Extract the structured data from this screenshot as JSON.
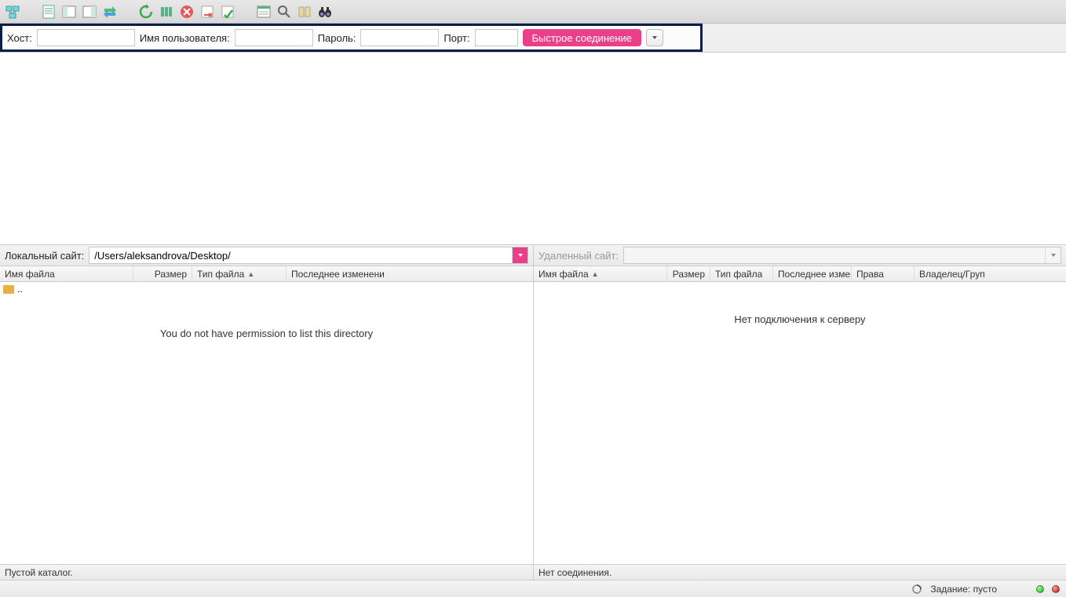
{
  "quickconnect": {
    "host_label": "Хост:",
    "username_label": "Имя пользователя:",
    "password_label": "Пароль:",
    "port_label": "Порт:",
    "button": "Быстрое соединение",
    "host_value": "",
    "username_value": "",
    "password_value": "",
    "port_value": ""
  },
  "local": {
    "label": "Локальный сайт:",
    "path": "/Users/aleksandrova/Desktop/",
    "columns": {
      "name": "Имя файла",
      "size": "Размер",
      "type": "Тип файла",
      "modified": "Последнее изменени"
    },
    "parent_dir": "..",
    "message": "You do not have permission to list this directory",
    "status": "Пустой каталог."
  },
  "remote": {
    "label": "Удаленный сайт:",
    "path": "",
    "columns": {
      "name": "Имя файла",
      "size": "Размер",
      "type": "Тип файла",
      "modified": "Последнее измен",
      "perms": "Права",
      "owner": "Владелец/Груп"
    },
    "message": "Нет подключения к серверу",
    "status": "Нет соединения."
  },
  "statusbar": {
    "queue": "Задание: пусто"
  }
}
